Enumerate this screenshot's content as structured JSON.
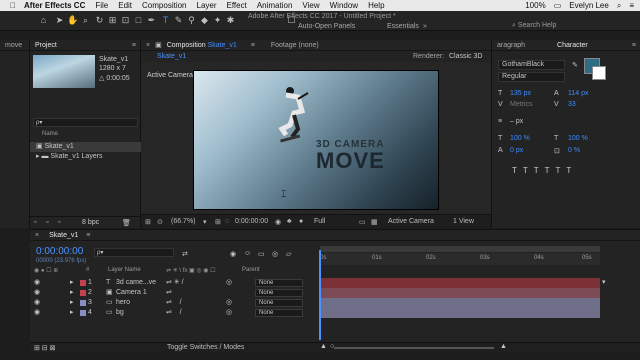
{
  "menubar": {
    "app": "After Effects CC",
    "items": [
      "File",
      "Edit",
      "Composition",
      "Layer",
      "Effect",
      "Animation",
      "View",
      "Window",
      "Help"
    ],
    "battery": "100%",
    "user": "Evelyn Lee"
  },
  "toolbar": {
    "window_title": "Adobe After Effects CC 2017 - Untitled Project *",
    "auto_open": "Auto-Open Panels",
    "workspaces": [
      "Essentials"
    ],
    "search": "Search Help"
  },
  "project": {
    "tab_move": "move",
    "tab": "Project",
    "item_name": "Skate_v1",
    "item_size": "1280 x 7",
    "item_duration": "△ 0:00:05",
    "search_placeholder": "ρ▾",
    "col_name": "Name",
    "items": [
      "Skate_v1",
      "Skate_v1 Layers"
    ],
    "bpc": "8 bpc"
  },
  "composition": {
    "tab": "Composition",
    "comp_name": "Skate_v1",
    "footage": "Footage (none)",
    "subtab": "Skate_v1",
    "renderer_label": "Renderer:",
    "renderer": "Classic 3D",
    "active_camera": "Active Camera",
    "title_line1": "3D CAMERA",
    "title_line2": "MOVE",
    "zoom": "(66.7%)",
    "timecode": "0:00:00:00",
    "quality": "Full",
    "view": "Active Camera",
    "views": "1 View"
  },
  "character": {
    "tab_paragraph": "aragraph",
    "tab": "Character",
    "font": "GothamBlack",
    "style": "Regular",
    "size": "135 px",
    "leading": "114 px",
    "kerning": "Metrics",
    "tracking": "33",
    "stroke": "– px",
    "vscale": "100 %",
    "hscale": "100 %",
    "baseline": "0 px",
    "tsume": "0 %",
    "color_fill": "#2f6d86",
    "color_stroke": "#ffffff"
  },
  "timeline": {
    "tab": "Skate_v1",
    "timecode": "0:00:00:00",
    "timecode_sub": "00000 (23.976 fps)",
    "col_layer_name": "Layer Name",
    "col_parent": "Parent",
    "ticks": [
      "0s",
      "01s",
      "02s",
      "03s",
      "04s",
      "05s"
    ],
    "toggle": "Toggle Switches / Modes",
    "layers": [
      {
        "num": "1",
        "name": "3d came...ve",
        "color": "#c0434f",
        "parent": "None",
        "bar": "#7a3035"
      },
      {
        "num": "2",
        "name": "Camera 1",
        "color": "#c0434f",
        "parent": "None",
        "bar": "#6f6f8a"
      },
      {
        "num": "3",
        "name": "hero",
        "color": "#8c8cc4",
        "parent": "None",
        "bar": "#6f6f8a"
      },
      {
        "num": "4",
        "name": "bg",
        "color": "#8c8cc4",
        "parent": "None",
        "bar": "#6f6f8a"
      }
    ]
  }
}
